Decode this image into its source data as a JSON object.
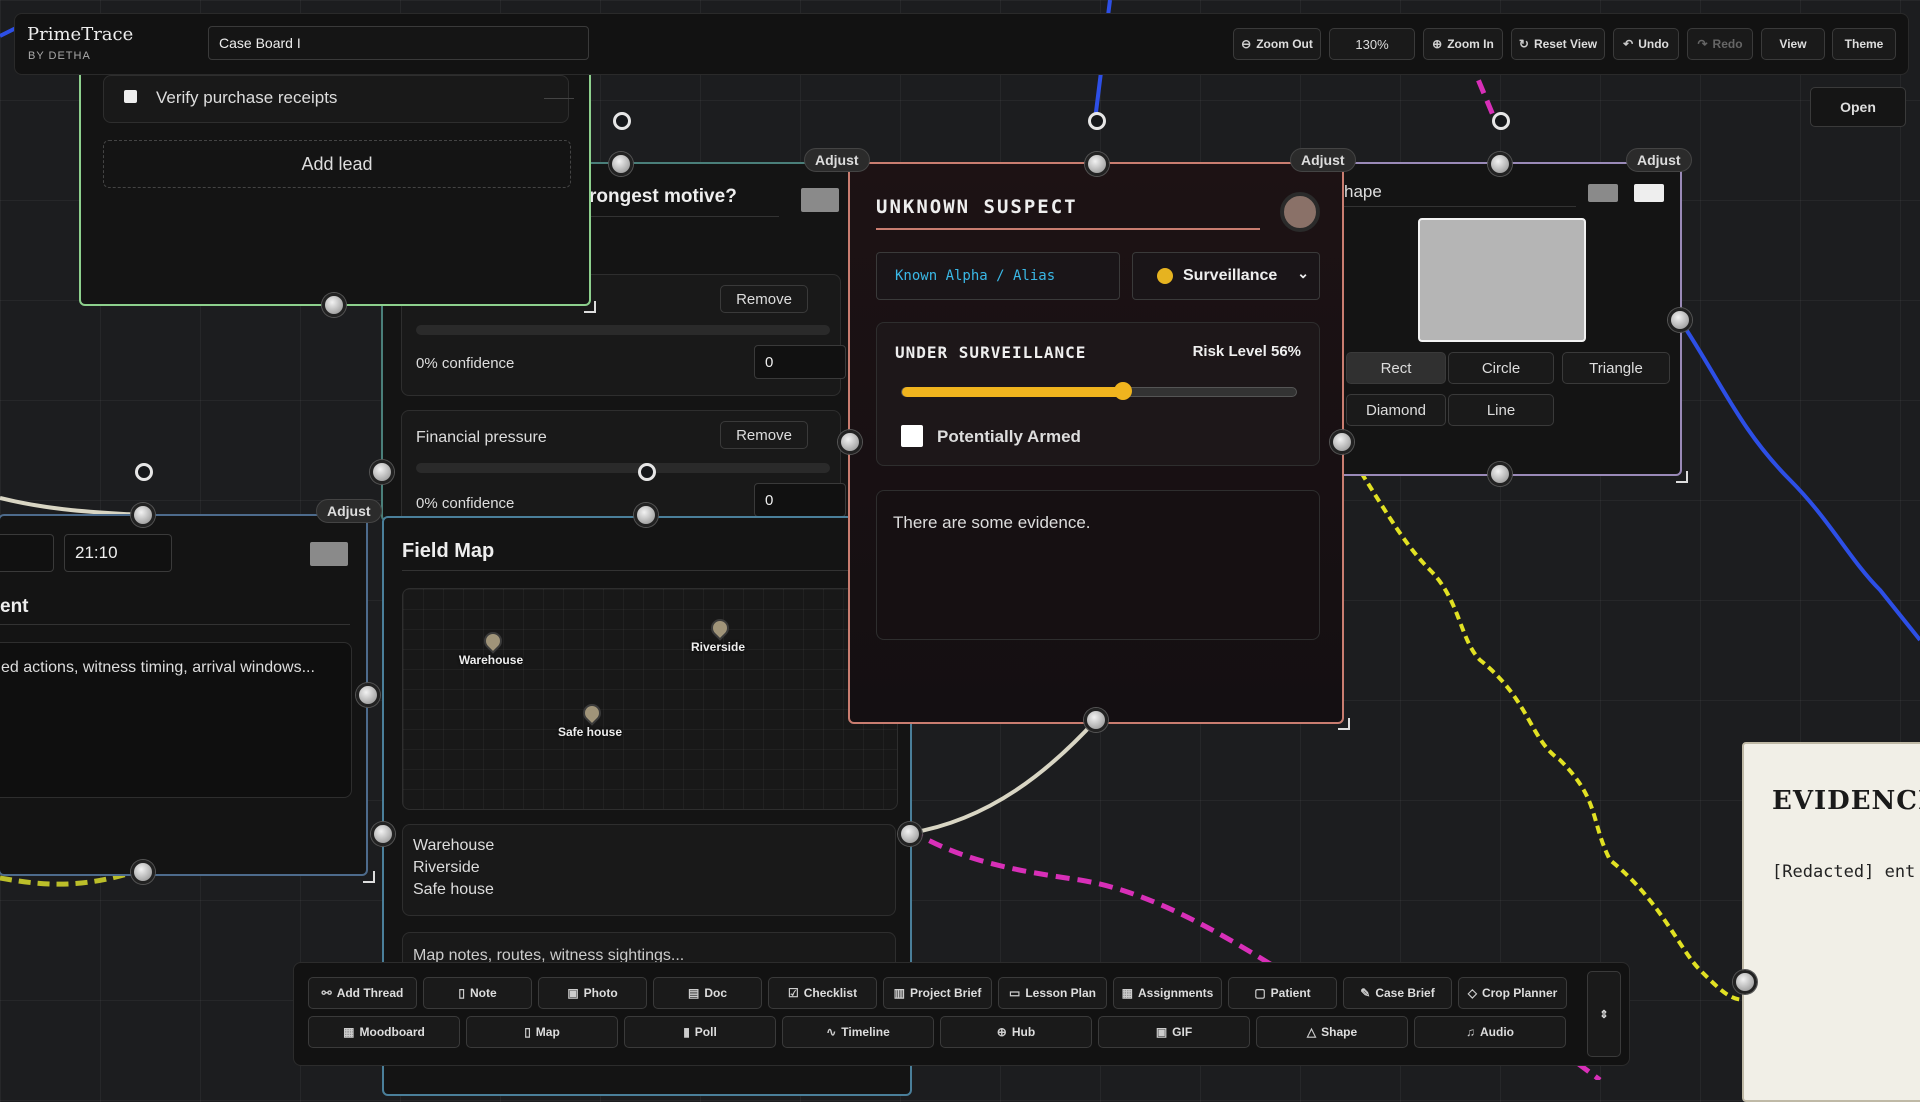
{
  "app": {
    "name": "PrimeTrace",
    "byline": "BY DETHA",
    "board_name": "Case Board I"
  },
  "toolbar": {
    "zoom_out": "Zoom Out",
    "zoom_level": "130%",
    "zoom_in": "Zoom In",
    "reset_view": "Reset View",
    "undo": "Undo",
    "redo": "Redo",
    "view": "View",
    "theme": "Theme",
    "open": "Open"
  },
  "adjust_label": "Adjust",
  "leads_card": {
    "checklist_item": "Verify purchase receipts",
    "add_lead": "Add lead"
  },
  "motive_card": {
    "title_fragment": "rongest motive?",
    "remove_label": "Remove",
    "factor_2": "Financial pressure",
    "confidence_1": "0% confidence",
    "confidence_1_value": "0",
    "confidence_2": "0% confidence",
    "confidence_2_value": "0"
  },
  "timeline_card": {
    "time_value": "21:10",
    "title_fragment": "ent",
    "notes": "ed actions, witness timing, arrival windows..."
  },
  "map_card": {
    "title": "Field Map",
    "pins": [
      "Warehouse",
      "Riverside",
      "Safe house"
    ],
    "locations_list": [
      "Warehouse",
      "Riverside",
      "Safe house"
    ],
    "notes_placeholder": "Map notes, routes, witness sightings..."
  },
  "suspect_card": {
    "title": "UNKNOWN SUSPECT",
    "alias": "Known Alpha / Alias",
    "status_selected": "Surveillance",
    "status_label": "UNDER SURVEILLANCE",
    "risk_label": "Risk Level 56%",
    "risk_value": 56,
    "armed_label": "Potentially Armed",
    "armed_checked": false,
    "notes": "There are some evidence.",
    "accent": "#c97d70"
  },
  "shape_card": {
    "title_fragment": "hape",
    "options": [
      "Rect",
      "Circle",
      "Triangle",
      "Diamond",
      "Line"
    ],
    "selected": "Rect"
  },
  "evidence_card": {
    "title": "EVIDENCI",
    "body": "[Redacted] ent"
  },
  "add_bar": {
    "row1": [
      {
        "label": "Add Thread",
        "icon": "thread-icon",
        "glyph": "⚯"
      },
      {
        "label": "Note",
        "icon": "note-icon",
        "glyph": "▯"
      },
      {
        "label": "Photo",
        "icon": "photo-icon",
        "glyph": "▣"
      },
      {
        "label": "Doc",
        "icon": "doc-icon",
        "glyph": "▤"
      },
      {
        "label": "Checklist",
        "icon": "checklist-icon",
        "glyph": "☑"
      },
      {
        "label": "Project Brief",
        "icon": "brief-icon",
        "glyph": "▥"
      },
      {
        "label": "Lesson Plan",
        "icon": "lesson-icon",
        "glyph": "▭"
      },
      {
        "label": "Assignments",
        "icon": "assignments-icon",
        "glyph": "▦"
      },
      {
        "label": "Patient",
        "icon": "patient-icon",
        "glyph": "▢"
      },
      {
        "label": "Case Brief",
        "icon": "pen-icon",
        "glyph": "✎"
      },
      {
        "label": "Crop Planner",
        "icon": "crop-icon",
        "glyph": "◇"
      }
    ],
    "row2": [
      {
        "label": "Moodboard",
        "icon": "moodboard-icon",
        "glyph": "▦"
      },
      {
        "label": "Map",
        "icon": "map-icon",
        "glyph": "▯"
      },
      {
        "label": "Poll",
        "icon": "poll-icon",
        "glyph": "▮"
      },
      {
        "label": "Timeline",
        "icon": "timeline-icon",
        "glyph": "∿"
      },
      {
        "label": "Hub",
        "icon": "hub-icon",
        "glyph": "⊕"
      },
      {
        "label": "GIF",
        "icon": "gif-icon",
        "glyph": "▣"
      },
      {
        "label": "Shape",
        "icon": "shape-icon",
        "glyph": "△"
      },
      {
        "label": "Audio",
        "icon": "audio-icon",
        "glyph": "♫"
      }
    ]
  }
}
